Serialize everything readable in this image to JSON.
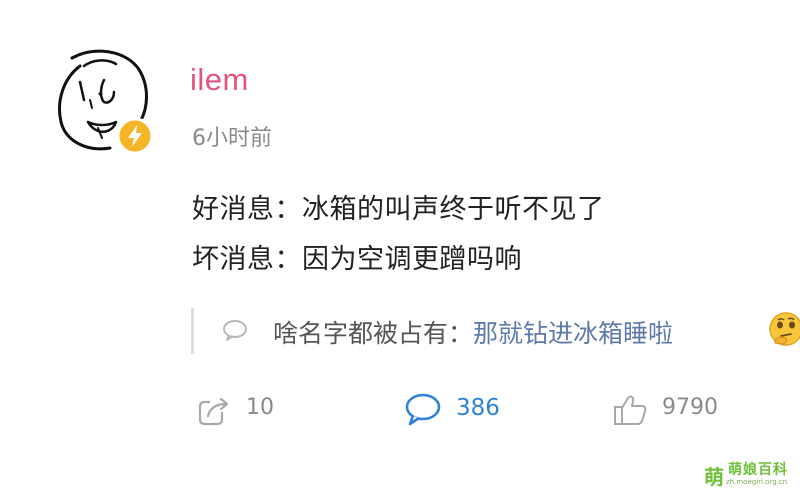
{
  "author": {
    "name": "ilem",
    "avatar_icon": "hand-drawn-face-avatar",
    "badge_icon": "lightning-verified-badge-icon",
    "badge_color": "#f6b526"
  },
  "post": {
    "time": "6小时前",
    "lines": [
      "好消息：冰箱的叫声终于听不见了",
      "坏消息：因为空调更蹭吗响"
    ]
  },
  "reply": {
    "icon": "speech-bubble-icon",
    "user": "啥名字都被占有：",
    "text": "那就钻进冰箱睡啦",
    "emoji": "thinking-face-emoji"
  },
  "actions": {
    "share": {
      "icon": "share-icon",
      "count": "10"
    },
    "comment": {
      "icon": "comment-icon",
      "count": "386",
      "color": "#2e83d8"
    },
    "like": {
      "icon": "thumbs-up-icon",
      "count": "9790"
    }
  },
  "watermark": {
    "title": "萌娘百科",
    "url": "zh.moegirl.org.cn"
  },
  "colors": {
    "username": "#e3557f",
    "link": "#5d7aa8",
    "muted": "#8a8a8a"
  }
}
